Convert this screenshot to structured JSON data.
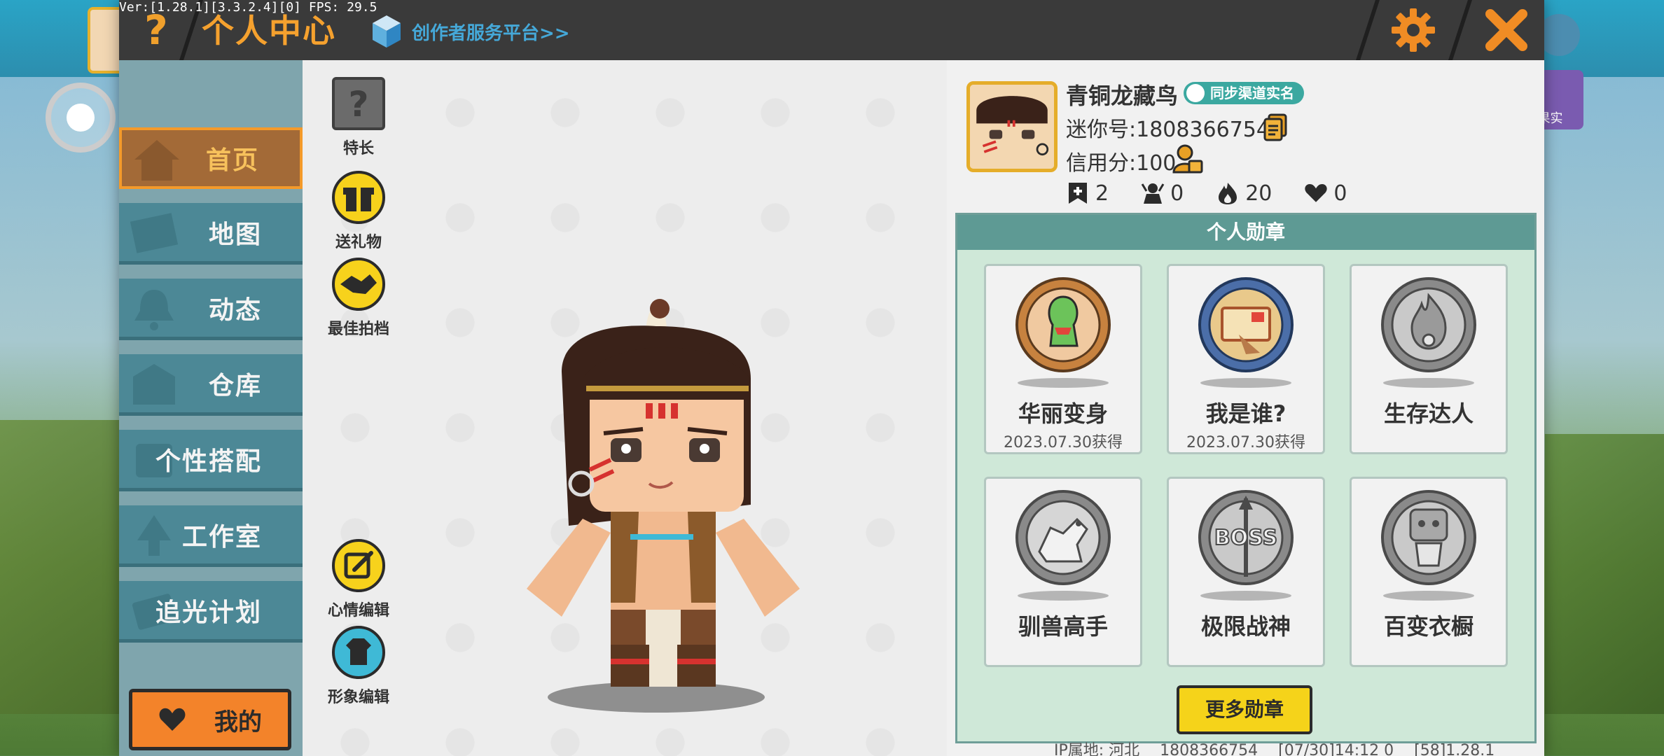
{
  "debug": {
    "version_line": "Ver:[1.28.1][3.3.2.4][0] FPS: 29.5"
  },
  "background": {
    "right_badge_text": "果实"
  },
  "header": {
    "title": "个人中心",
    "creator_platform_link": "创作者服务平台>>",
    "icons": {
      "help": "help-icon",
      "settings": "gear-icon",
      "close": "close-icon"
    }
  },
  "sidebar": {
    "items": [
      {
        "label": "首页",
        "icon": "house-icon",
        "active": true
      },
      {
        "label": "地图",
        "icon": "map-icon",
        "active": false
      },
      {
        "label": "动态",
        "icon": "bell-icon",
        "active": false
      },
      {
        "label": "仓库",
        "icon": "warehouse-icon",
        "active": false
      },
      {
        "label": "个性搭配",
        "icon": "outfit-icon",
        "active": false
      },
      {
        "label": "工作室",
        "icon": "studio-icon",
        "active": false
      },
      {
        "label": "追光计划",
        "icon": "light-plan-icon",
        "active": false
      }
    ],
    "mine_button": "我的"
  },
  "stage": {
    "buttons": [
      {
        "label": "特长",
        "icon": "question-block-icon"
      },
      {
        "label": "送礼物",
        "icon": "gift-icon"
      },
      {
        "label": "最佳拍档",
        "icon": "handshake-icon"
      },
      {
        "label": "心情编辑",
        "icon": "edit-icon"
      },
      {
        "label": "形象编辑",
        "icon": "outfit-edit-icon"
      }
    ]
  },
  "profile": {
    "name": "青铜龙藏鸟",
    "verify_badge": "同步渠道实名",
    "mini_id": "迷你号:1808366754",
    "credit": "信用分:100",
    "stats": [
      {
        "icon": "bookmark-plus-icon",
        "value": "2"
      },
      {
        "icon": "fans-icon",
        "value": "0"
      },
      {
        "icon": "flame-icon",
        "value": "20"
      },
      {
        "icon": "heart-icon",
        "value": "0"
      }
    ],
    "medals_title": "个人勋章",
    "medals": [
      {
        "name": "华丽变身",
        "date": "2023.07.30获得",
        "icon": "transform-medal-icon",
        "unlocked": true
      },
      {
        "name": "我是谁?",
        "date": "2023.07.30获得",
        "icon": "whoami-medal-icon",
        "unlocked": true
      },
      {
        "name": "生存达人",
        "date": "",
        "icon": "survival-medal-icon",
        "unlocked": false
      },
      {
        "name": "驯兽高手",
        "date": "",
        "icon": "tamer-medal-icon",
        "unlocked": false
      },
      {
        "name": "极限战神",
        "date": "",
        "icon": "boss-medal-icon",
        "unlocked": false
      },
      {
        "name": "百变衣橱",
        "date": "",
        "icon": "wardrobe-medal-icon",
        "unlocked": false
      }
    ],
    "more_medals_button": "更多勋章"
  },
  "footer": {
    "ip_location": "IP属地: 河北",
    "uid": "1808366754",
    "time": "[07/30]14:12 0",
    "build": "[58]1.28.1"
  },
  "colors": {
    "accent_orange": "#f5a12e",
    "nav_teal": "#4c8896",
    "nav_active": "#a36a37",
    "medal_header": "#5e9a94",
    "more_button": "#f5d31a"
  }
}
